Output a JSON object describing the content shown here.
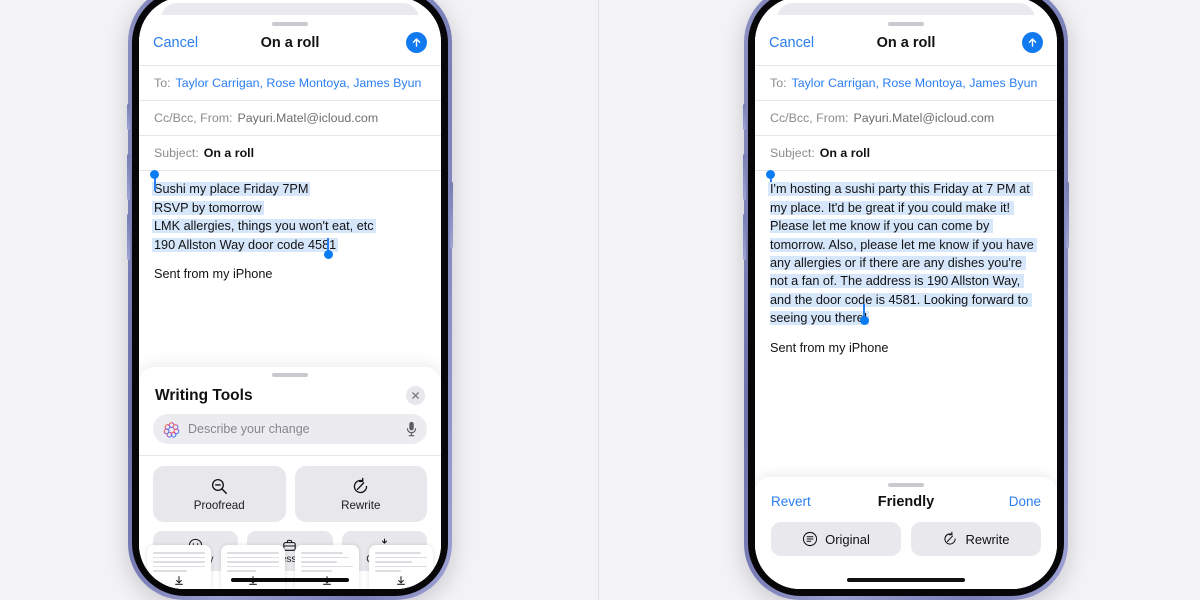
{
  "colors": {
    "background": "#f3f3f5",
    "accent_blue": "#2a7ef0",
    "send_blue": "#1279ef",
    "selection_blue": "#d6e6fb",
    "button_gray": "#e8e8ec",
    "frame_titanium": "#8e92c4"
  },
  "mail": {
    "nav": {
      "cancel_label": "Cancel",
      "title": "On a roll",
      "send_icon": "arrow-up-icon"
    },
    "fields": [
      {
        "label": "To:",
        "value": "Taylor Carrigan, Rose Montoya, James Byun",
        "style": "recipients"
      },
      {
        "label": "Cc/Bcc, From:",
        "value": "Payuri.Matel@icloud.com",
        "style": "plain"
      },
      {
        "label": "Subject:",
        "value": "On a roll",
        "style": "subject"
      }
    ],
    "signature": "Sent from my iPhone"
  },
  "left_phone": {
    "body_lines": [
      "Sushi my place Friday 7PM",
      "RSVP by tomorrow",
      "LMK allergies, things you won't eat, etc",
      "190 Allston Way door code 4581"
    ],
    "writing_tools": {
      "title": "Writing Tools",
      "close_icon": "close-icon",
      "search": {
        "placeholder": "Describe your change",
        "leading_icon": "apple-intelligence-icon",
        "trailing_icon": "microphone-icon"
      },
      "primary_actions": [
        {
          "label": "Proofread",
          "icon": "magnifier-minus-icon"
        },
        {
          "label": "Rewrite",
          "icon": "rewrite-circle-icon"
        }
      ],
      "tone_actions": [
        {
          "label": "Friendly",
          "icon": "smiley-face-icon"
        },
        {
          "label": "Professional",
          "icon": "briefcase-icon"
        },
        {
          "label": "Concise",
          "icon": "compress-vertical-icon"
        }
      ]
    },
    "docs_strip": {
      "count": 4,
      "download_icon": "download-arrow-icon"
    }
  },
  "right_phone": {
    "body_text": "I'm hosting a sushi party this Friday at 7 PM at my place. It'd be great if you could make it! Please let me know if you can come by tomorrow. Also, please let me know if you have any allergies or if there are any dishes you're not a fan of. The address is 190 Allston Way, and the door code is 4581. Looking forward to seeing you there!",
    "rewrite_bar": {
      "revert_label": "Revert",
      "mode_label": "Friendly",
      "done_label": "Done",
      "actions": [
        {
          "label": "Original",
          "icon": "original-lines-circle-icon"
        },
        {
          "label": "Rewrite",
          "icon": "rewrite-circle-icon"
        }
      ]
    }
  }
}
